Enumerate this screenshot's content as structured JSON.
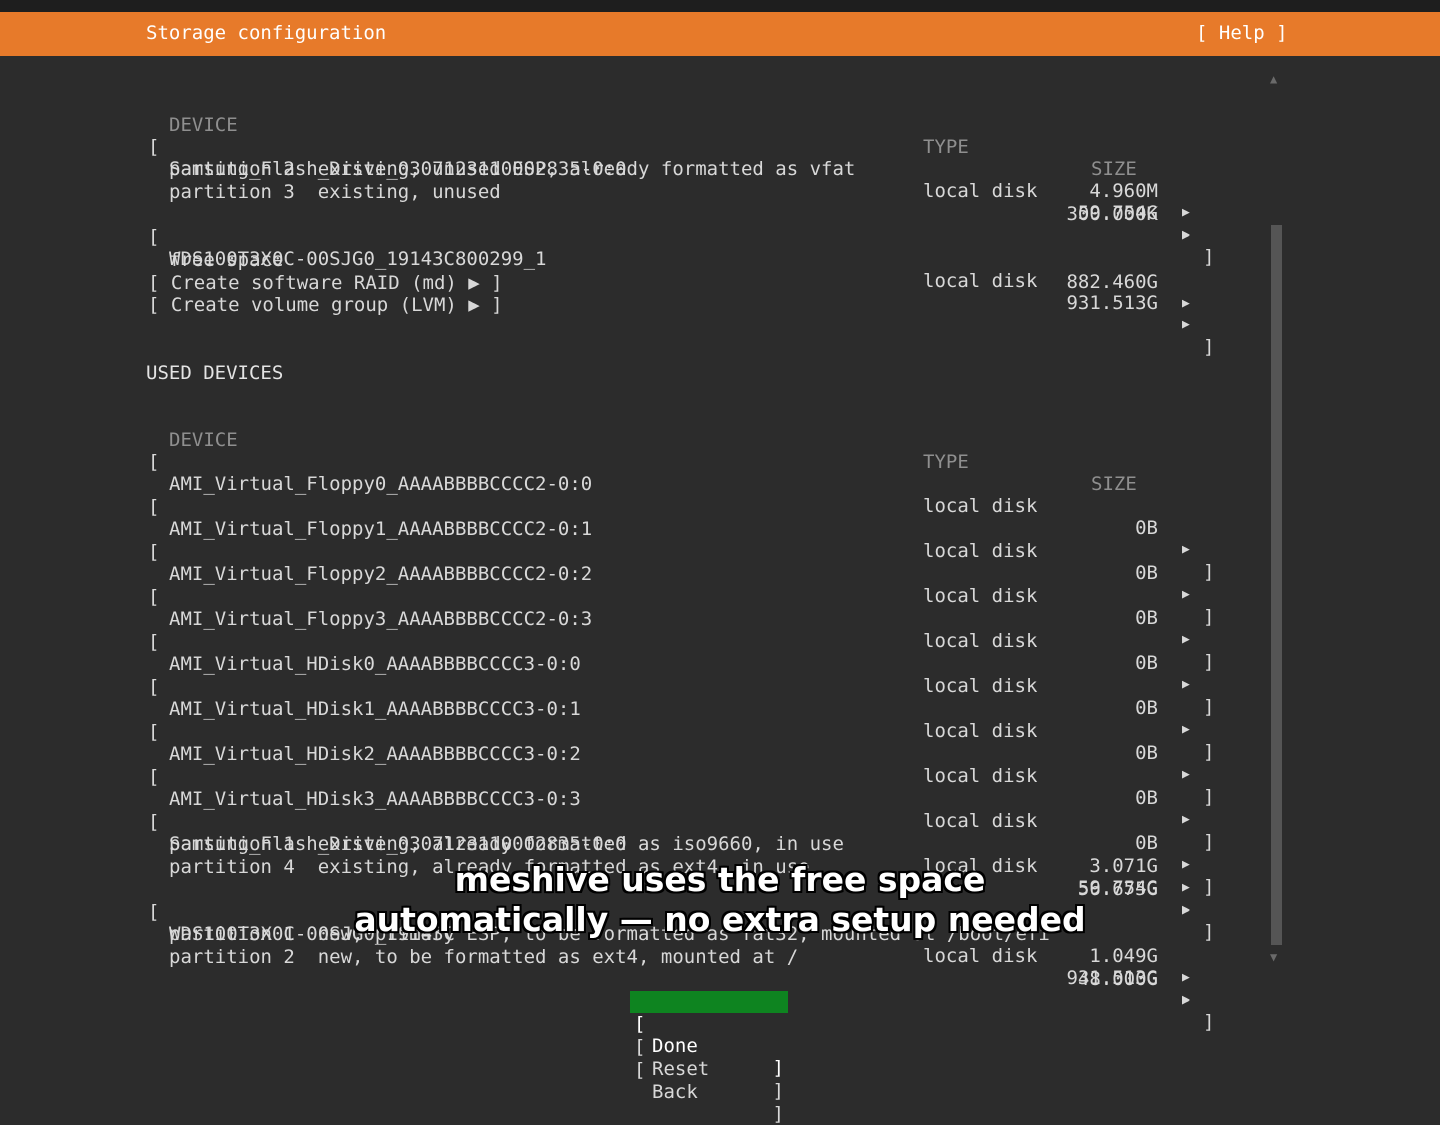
{
  "header": {
    "title": "Storage configuration",
    "help": "[ Help ]"
  },
  "available": {
    "col_device": "DEVICE",
    "col_type": "TYPE",
    "col_size": "SIZE",
    "disk1": {
      "name": "Samsung_Flash_Drive_0307123110002835-0:0",
      "type": "local disk",
      "size": "59.754G"
    },
    "disk1_part2": {
      "label": "partition 2  existing, unused ESP, already formatted as vfat",
      "size": "4.960M"
    },
    "disk1_part3": {
      "label": "partition 3  existing, unused",
      "size": "300.000K"
    },
    "disk2": {
      "name": "WDS100T3X0C-00SJG0_19143C800299_1",
      "type": "local disk",
      "size": "931.513G"
    },
    "disk2_free": {
      "label": "free space",
      "size": "882.460G"
    },
    "raid": "[ Create software RAID (md) ▶ ]",
    "lvm": "[ Create volume group (LVM) ▶ ]"
  },
  "used": {
    "section_title": "USED DEVICES",
    "col_device": "DEVICE",
    "col_type": "TYPE",
    "col_size": "SIZE",
    "d0": {
      "name": "AMI_Virtual_Floppy0_AAAABBBBCCCC2-0:0",
      "type": "local disk",
      "size": "0B"
    },
    "d1": {
      "name": "AMI_Virtual_Floppy1_AAAABBBBCCCC2-0:1",
      "type": "local disk",
      "size": "0B"
    },
    "d2": {
      "name": "AMI_Virtual_Floppy2_AAAABBBBCCCC2-0:2",
      "type": "local disk",
      "size": "0B"
    },
    "d3": {
      "name": "AMI_Virtual_Floppy3_AAAABBBBCCCC2-0:3",
      "type": "local disk",
      "size": "0B"
    },
    "d4": {
      "name": "AMI_Virtual_HDisk0_AAAABBBBCCCC3-0:0",
      "type": "local disk",
      "size": "0B"
    },
    "d5": {
      "name": "AMI_Virtual_HDisk1_AAAABBBBCCCC3-0:1",
      "type": "local disk",
      "size": "0B"
    },
    "d6": {
      "name": "AMI_Virtual_HDisk2_AAAABBBBCCCC3-0:2",
      "type": "local disk",
      "size": "0B"
    },
    "d7": {
      "name": "AMI_Virtual_HDisk3_AAAABBBBCCCC3-0:3",
      "type": "local disk",
      "size": "0B"
    },
    "samsung": {
      "name": "Samsung_Flash_Drive_0307123110002835-0:0",
      "type": "local disk",
      "size": "59.754G"
    },
    "samsung_p1": {
      "label": "partition 1  existing, already formatted as iso9660, in use",
      "size": "3.071G"
    },
    "samsung_p4": {
      "label": "partition 4  existing, already formatted as ext4, in use",
      "size": "56.675G"
    },
    "wd": {
      "name": "WDS100T3X0C-00SJG0_19143C",
      "type": "local disk",
      "size": "931.513G"
    },
    "wd_p1": {
      "label": "partition 1  new, primary ESP, to be formatted as fat32, mounted at /boot/efi",
      "size": "1.049G"
    },
    "wd_p2": {
      "label": "partition 2  new, to be formatted as ext4, mounted at /",
      "size": "48.000G"
    }
  },
  "buttons": {
    "done": "Done",
    "reset": "Reset",
    "back": "Back"
  },
  "caption": {
    "line1": "meshive uses the free space",
    "line2": "automatically — no extra setup needed"
  },
  "glyphs": {
    "arrow": "▶",
    "open": "[",
    "close": "]",
    "scroll_up": "▲",
    "scroll_down": "▼"
  },
  "colors": {
    "header_bg": "#e77a2a",
    "focus_bg": "#0e8420",
    "background": "#2c2c2c"
  }
}
